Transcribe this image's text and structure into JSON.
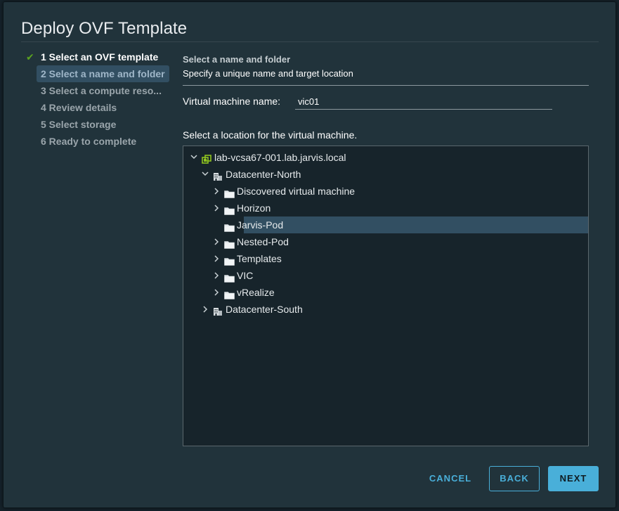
{
  "dialog": {
    "title": "Deploy OVF Template"
  },
  "steps": [
    {
      "label": "1 Select an OVF template",
      "state": "done"
    },
    {
      "label": "2 Select a name and folder",
      "state": "active"
    },
    {
      "label": "3 Select a compute reso...",
      "state": "pending"
    },
    {
      "label": "4 Review details",
      "state": "pending"
    },
    {
      "label": "5 Select storage",
      "state": "pending"
    },
    {
      "label": "6 Ready to complete",
      "state": "pending"
    }
  ],
  "section": {
    "title": "Select a name and folder",
    "subtitle": "Specify a unique name and target location"
  },
  "vm_name": {
    "label": "Virtual machine name:",
    "value": "vic01"
  },
  "location": {
    "label": "Select a location for the virtual machine."
  },
  "tree": [
    {
      "label": "lab-vcsa67-001.lab.jarvis.local",
      "icon": "vcenter-icon",
      "depth": 0,
      "expander": "expanded",
      "selected": false
    },
    {
      "label": "Datacenter-North",
      "icon": "datacenter-icon",
      "depth": 1,
      "expander": "expanded",
      "selected": false
    },
    {
      "label": "Discovered virtual machine",
      "icon": "folder-icon",
      "depth": 2,
      "expander": "collapsed",
      "selected": false
    },
    {
      "label": "Horizon",
      "icon": "folder-icon",
      "depth": 2,
      "expander": "collapsed",
      "selected": false
    },
    {
      "label": "Jarvis-Pod",
      "icon": "folder-icon",
      "depth": 2,
      "expander": "none",
      "selected": true
    },
    {
      "label": "Nested-Pod",
      "icon": "folder-icon",
      "depth": 2,
      "expander": "collapsed",
      "selected": false
    },
    {
      "label": "Templates",
      "icon": "folder-icon",
      "depth": 2,
      "expander": "collapsed",
      "selected": false
    },
    {
      "label": "VIC",
      "icon": "folder-icon",
      "depth": 2,
      "expander": "collapsed",
      "selected": false
    },
    {
      "label": "vRealize",
      "icon": "folder-icon",
      "depth": 2,
      "expander": "collapsed",
      "selected": false
    },
    {
      "label": "Datacenter-South",
      "icon": "datacenter-icon",
      "depth": 1,
      "expander": "collapsed",
      "selected": false
    }
  ],
  "buttons": {
    "cancel": "CANCEL",
    "back": "BACK",
    "next": "NEXT"
  },
  "colors": {
    "accent": "#49afd9",
    "check": "#5aa220",
    "selection": "#324f62",
    "dialog_bg": "#21333b"
  }
}
